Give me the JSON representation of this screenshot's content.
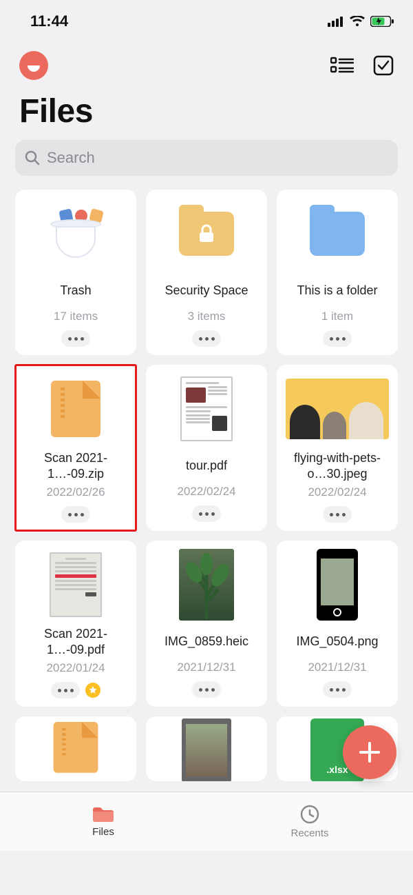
{
  "status": {
    "time": "11:44"
  },
  "header": {
    "page_title": "Files"
  },
  "search": {
    "placeholder": "Search"
  },
  "tiles": [
    {
      "name": "Trash",
      "meta": "17 items",
      "kind": "trash"
    },
    {
      "name": "Security Space",
      "meta": "3 items",
      "kind": "folder-lock"
    },
    {
      "name": "This is a folder",
      "meta": "1 item",
      "kind": "folder-blue"
    },
    {
      "name": "Scan 2021-1…-09.zip",
      "meta": "2022/02/26",
      "kind": "zip",
      "highlight": true
    },
    {
      "name": "tour.pdf",
      "meta": "2022/02/24",
      "kind": "pdf"
    },
    {
      "name": "flying-with-pets-o…30.jpeg",
      "meta": "2022/02/24",
      "kind": "photo-pets"
    },
    {
      "name": "Scan 2021-1…-09.pdf",
      "meta": "2022/01/24",
      "kind": "pdf-scan",
      "star": true
    },
    {
      "name": "IMG_0859.heic",
      "meta": "2021/12/31",
      "kind": "photo-plant"
    },
    {
      "name": "IMG_0504.png",
      "meta": "2021/12/31",
      "kind": "photo-phone"
    }
  ],
  "partial": [
    {
      "kind": "zip"
    },
    {
      "kind": "video"
    },
    {
      "kind": "xlsx",
      "ext_label": ".xlsx"
    }
  ],
  "tabs": {
    "files": "Files",
    "recents": "Recents"
  }
}
